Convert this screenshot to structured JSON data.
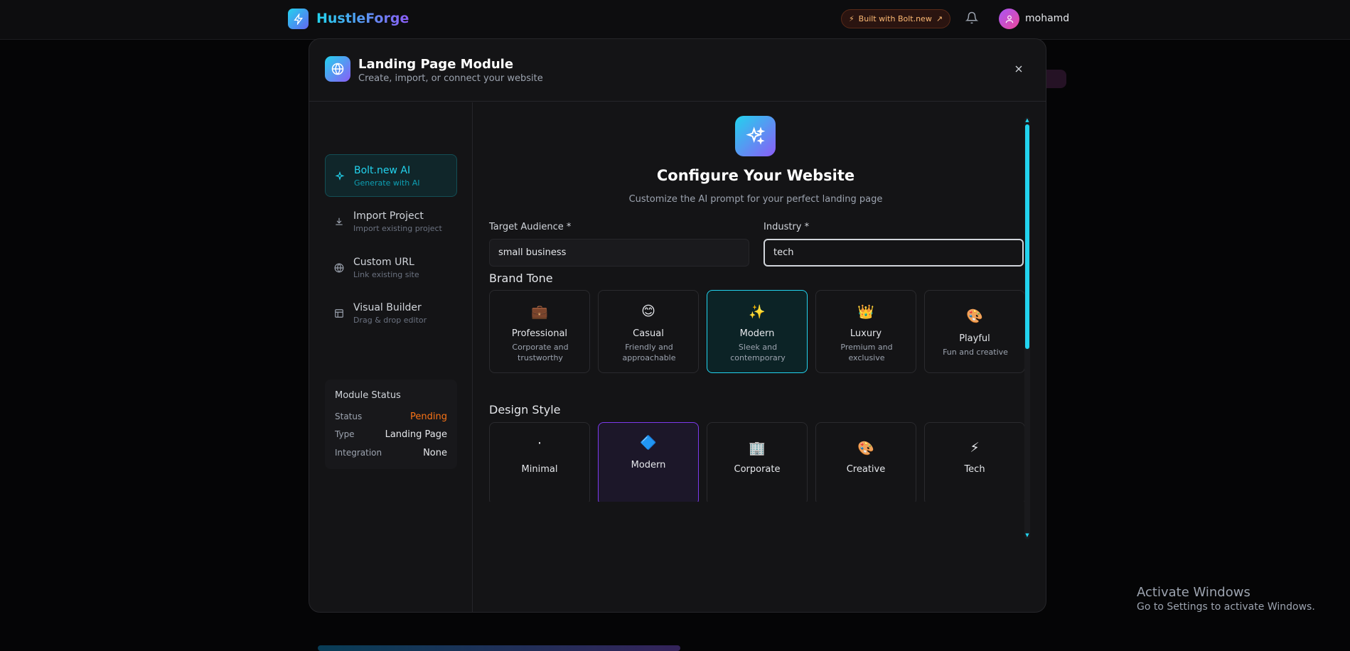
{
  "app": {
    "name": "HustleForge",
    "built_with": "Built with Bolt.new",
    "username": "mohamd"
  },
  "modal": {
    "title": "Landing Page Module",
    "subtitle": "Create, import, or connect your website"
  },
  "sidebar": {
    "items": [
      {
        "label": "Bolt.new AI",
        "desc": "Generate with AI",
        "icon": "sparkles-icon",
        "active": true
      },
      {
        "label": "Import Project",
        "desc": "Import existing project",
        "icon": "download-icon",
        "active": false
      },
      {
        "label": "Custom URL",
        "desc": "Link existing site",
        "icon": "globe-icon",
        "active": false
      },
      {
        "label": "Visual Builder",
        "desc": "Drag & drop editor",
        "icon": "layout-icon",
        "active": false
      }
    ],
    "status": {
      "title": "Module Status",
      "rows": [
        {
          "key": "Status",
          "value": "Pending"
        },
        {
          "key": "Type",
          "value": "Landing Page"
        },
        {
          "key": "Integration",
          "value": "None"
        }
      ]
    }
  },
  "main": {
    "title": "Configure Your Website",
    "subtitle": "Customize the AI prompt for your perfect landing page",
    "target_audience": {
      "label": "Target Audience *",
      "value": "small business"
    },
    "industry": {
      "label": "Industry *",
      "value": "tech"
    },
    "brand_tone": {
      "title": "Brand Tone",
      "selected": "Modern",
      "options": [
        {
          "emoji": "💼",
          "label": "Professional",
          "desc": "Corporate and trustworthy"
        },
        {
          "emoji": "😊",
          "label": "Casual",
          "desc": "Friendly and approachable"
        },
        {
          "emoji": "✨",
          "label": "Modern",
          "desc": "Sleek and contemporary"
        },
        {
          "emoji": "👑",
          "label": "Luxury",
          "desc": "Premium and exclusive"
        },
        {
          "emoji": "🎨",
          "label": "Playful",
          "desc": "Fun and creative"
        }
      ]
    },
    "design_style": {
      "title": "Design Style",
      "selected": "Modern",
      "options": [
        {
          "emoji": "·",
          "label": "Minimal"
        },
        {
          "emoji": "🔷",
          "label": "Modern"
        },
        {
          "emoji": "🏢",
          "label": "Corporate"
        },
        {
          "emoji": "🎨",
          "label": "Creative"
        },
        {
          "emoji": "⚡",
          "label": "Tech"
        }
      ]
    }
  },
  "watermark": {
    "title": "Activate Windows",
    "subtitle": "Go to Settings to activate Windows."
  },
  "colors": {
    "accent": "#22d3ee",
    "pending": "#f97316",
    "purple": "#7c3aed"
  }
}
